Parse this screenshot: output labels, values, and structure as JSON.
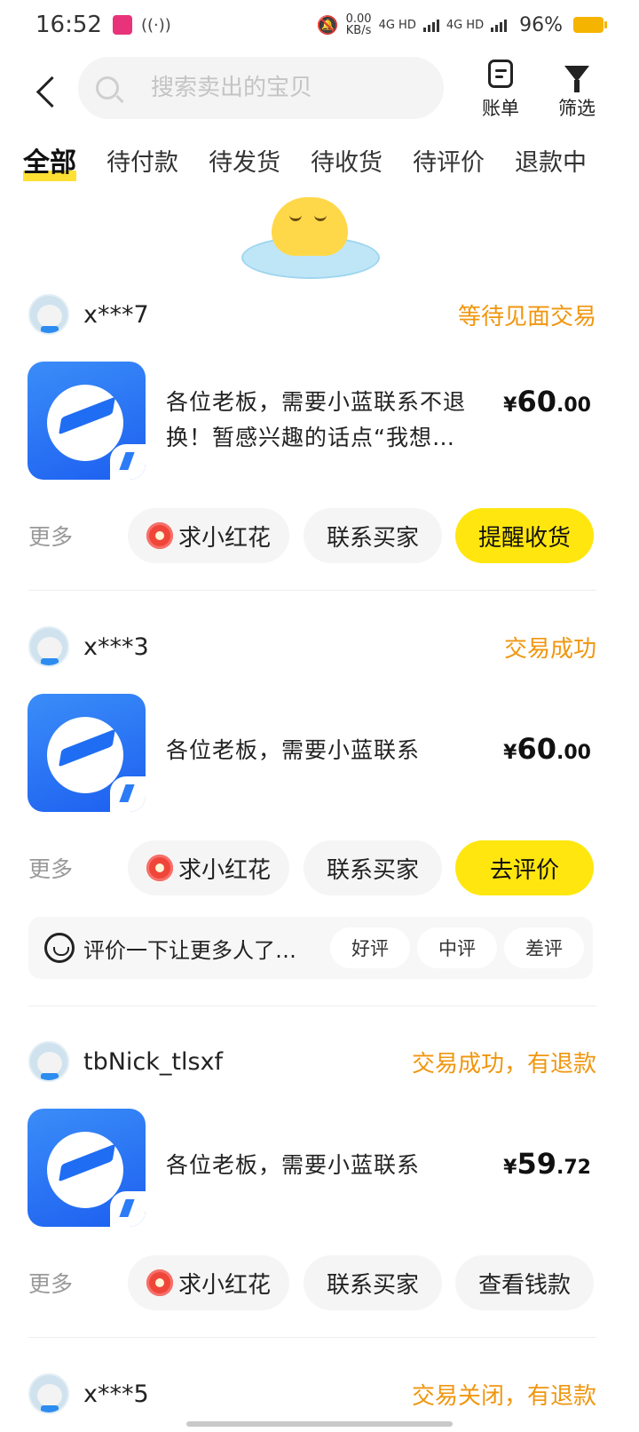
{
  "status_bar": {
    "time": "16:52",
    "net_speed": "0.00",
    "net_unit": "KB/s",
    "signal1": "4G HD",
    "signal2": "4G HD",
    "battery": "96%"
  },
  "header": {
    "search_placeholder": "搜索卖出的宝贝",
    "bill_label": "账单",
    "filter_label": "筛选"
  },
  "tabs": [
    "全部",
    "待付款",
    "待发货",
    "待收货",
    "待评价",
    "退款中"
  ],
  "orders": [
    {
      "seller": "x***7",
      "status": "等待见面交易",
      "title": "各位老板，需要小蓝联系不退换！暂感兴趣的话点“我想…",
      "price_currency": "¥",
      "price_int": "60",
      "price_dec": ".00",
      "more": "更多",
      "buttons": [
        "求小红花",
        "联系买家",
        "提醒收货"
      ]
    },
    {
      "seller": "x***3",
      "status": "交易成功",
      "title": "各位老板，需要小蓝联系",
      "price_currency": "¥",
      "price_int": "60",
      "price_dec": ".00",
      "more": "更多",
      "buttons": [
        "求小红花",
        "联系买家",
        "去评价"
      ],
      "rate": {
        "text": "评价一下让更多人了…",
        "options": [
          "好评",
          "中评",
          "差评"
        ]
      }
    },
    {
      "seller": "tbNick_tlsxf",
      "status": "交易成功，有退款",
      "title": "各位老板，需要小蓝联系",
      "price_currency": "¥",
      "price_int": "59",
      "price_dec": ".72",
      "more": "更多",
      "buttons": [
        "求小红花",
        "联系买家",
        "查看钱款"
      ]
    },
    {
      "seller": "x***5",
      "status": "交易关闭，有退款"
    }
  ],
  "colors": {
    "accent_yellow": "#ffe60f",
    "status_orange": "#f0960e",
    "product_blue": "#1c5ff0"
  }
}
